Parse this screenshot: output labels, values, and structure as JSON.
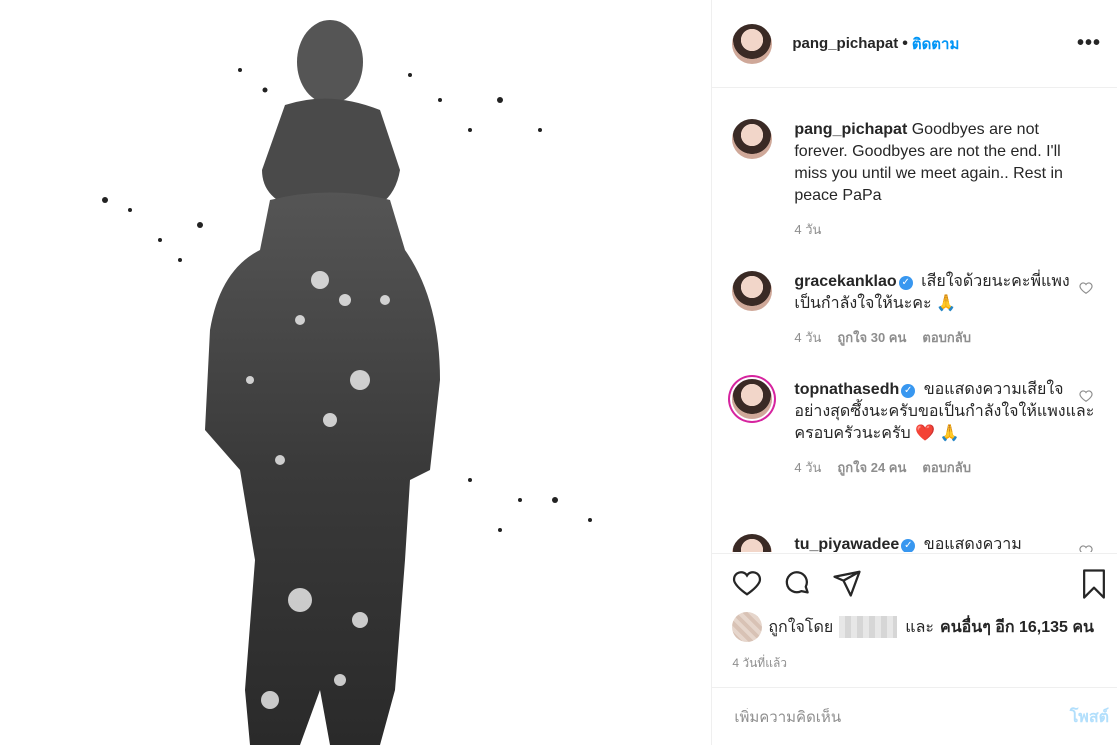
{
  "post": {
    "username": "pang_pichapat",
    "follow_label": "ติดตาม",
    "dot": "•",
    "more_label": "•••",
    "caption": "Goodbyes are not forever. Goodbyes are not the end. I'll miss you until we meet again.. Rest in peace PaPa",
    "caption_time": "4 วัน"
  },
  "comments": [
    {
      "username": "gracekanklao",
      "verified": true,
      "text": "เสียใจด้วยนะคะพี่แพง เป็นกำลังใจให้นะคะ 🙏",
      "time": "4 วัน",
      "likes": "ถูกใจ 30 คน",
      "reply": "ตอบกลับ"
    },
    {
      "username": "topnathasedh",
      "verified": true,
      "text": "ขอแสดงความเสียใจอย่างสุดซึ้งนะครับขอเป็นกำลังใจให้แพงและครอบครัวนะครับ ❤️ 🙏",
      "time": "4 วัน",
      "likes": "ถูกใจ 24 คน",
      "reply": "ตอบกลับ"
    },
    {
      "username": "tu_piyawadee",
      "verified": true,
      "text": "ขอแสดงความ",
      "time": "",
      "likes": "",
      "reply": ""
    }
  ],
  "likes_line": {
    "prefix": "ถูกใจโดย",
    "and": "และ",
    "others": "คนอื่นๆ อีก 16,135 คน"
  },
  "timestamp": "4 วันที่แล้ว",
  "comment_box": {
    "placeholder": "เพิ่มความคิดเห็น",
    "post_label": "โพสต์"
  },
  "icons": [
    "heart-icon",
    "comment-icon",
    "share-icon",
    "bookmark-icon",
    "more-icon",
    "verified-icon"
  ],
  "colors": {
    "accent": "#0095f6",
    "verified": "#3897f0",
    "post_disabled": "#b2dffc"
  }
}
